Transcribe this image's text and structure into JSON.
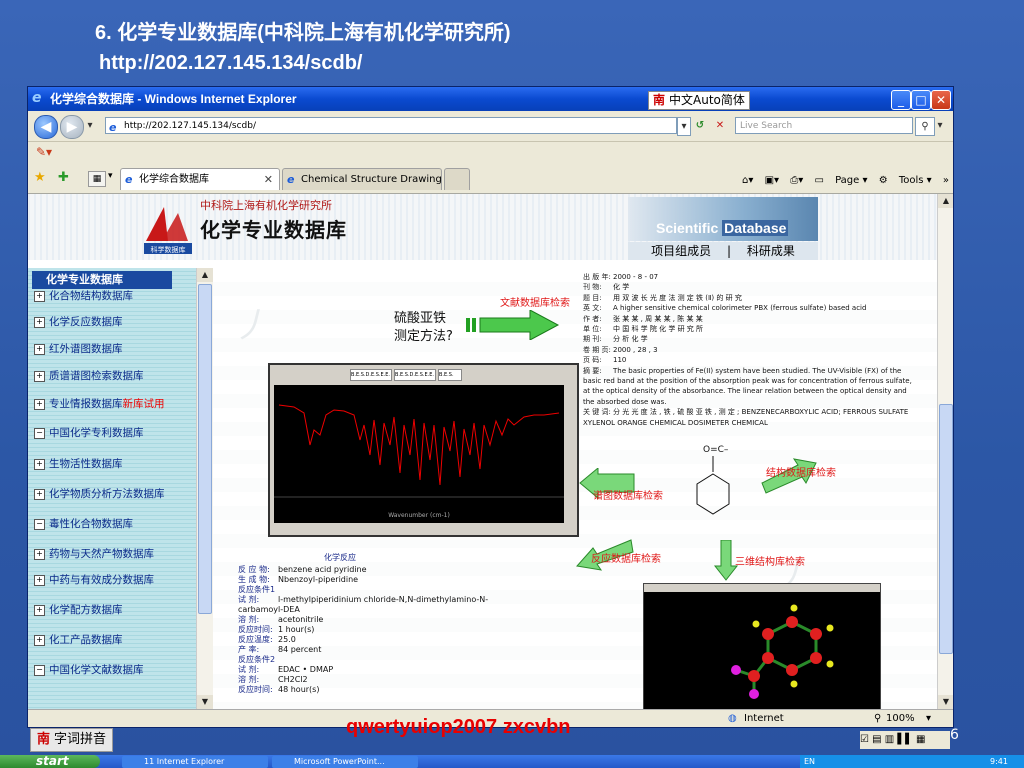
{
  "slide": {
    "title_line1": "6. 化学专业数据库(中科院上海有机化学研究所)",
    "title_line2": "http://202.127.145.134/scdb/",
    "caption": "qwertyuiop2007  zxcvbn",
    "page_number": "6"
  },
  "window": {
    "title": "化学综合数据库 - Windows Internet Explorer",
    "ime_label": "中文Auto简体",
    "ime_char": "南",
    "btn_min": "_",
    "btn_max": "□",
    "btn_close": "✕"
  },
  "address": {
    "url": "http://202.127.145.134/scdb/",
    "search_placeholder": "Live Search"
  },
  "tabs": [
    {
      "label": "化学综合数据库",
      "close": "✕"
    },
    {
      "label": "Chemical Structure Drawing ..."
    }
  ],
  "command_bar": {
    "page": "Page",
    "tools": "Tools"
  },
  "banner": {
    "org": "中科院上海有机化学研究所",
    "title": "化学专业数据库",
    "en_prefix": "Scientific ",
    "en_db": "Database",
    "link_members": "项目组成员",
    "sep": "|",
    "link_results": "科研成果",
    "logo_text": "科学数据库"
  },
  "sidebar": {
    "heading": "化学专业数据库",
    "items": [
      {
        "label": "化合物结构数据库",
        "sym": "+"
      },
      {
        "label": "化学反应数据库",
        "sym": "+"
      },
      {
        "label": "红外谱图数据库",
        "sym": "+"
      },
      {
        "label": "质谱谱图检索数据库",
        "sym": "+"
      },
      {
        "label": "专业情报数据库",
        "sym": "+",
        "hot": "新库试用"
      },
      {
        "label": "中国化学专利数据库",
        "sym": "−"
      },
      {
        "label": "生物活性数据库",
        "sym": "+"
      },
      {
        "label": "化学物质分析方法数据库",
        "sym": "+"
      },
      {
        "label": "毒性化合物数据库",
        "sym": "−"
      },
      {
        "label": "药物与天然产物数据库",
        "sym": "+"
      },
      {
        "label": "中药与有效成分数据库",
        "sym": "+"
      },
      {
        "label": "化学配方数据库",
        "sym": "+"
      },
      {
        "label": "化工产品数据库",
        "sym": "+"
      },
      {
        "label": "中国化学文献数据库",
        "sym": "−"
      }
    ]
  },
  "main": {
    "question_line1": "硫酸亚铁",
    "question_line2": "测定方法?",
    "label_lit": "文献数据库检索",
    "label_spec": "谱图数据库检索",
    "label_struct": "结构数据库检索",
    "label_rxn": "反应数据库检索",
    "label_3d": "三维结构库检索",
    "rxn_heading": "化学反应",
    "rxn_rows": [
      {
        "k": "反 应 物:",
        "v": "benzene acid pyridine"
      },
      {
        "k": "生 成 物:",
        "v": "Nbenzoyl-piperidine"
      },
      {
        "k": "反应条件1",
        "v": ""
      },
      {
        "k": "试    剂:",
        "v": "l-methylpiperidinium chloride-N,N-dimethylamino-N-carbamoyl-DEA"
      },
      {
        "k": "溶    剂:",
        "v": "acetonitrile"
      },
      {
        "k": "反应时间:",
        "v": "1 hour(s)"
      },
      {
        "k": "反应温度:",
        "v": "25.0"
      },
      {
        "k": "产    率:",
        "v": "84 percent"
      },
      {
        "k": "反应条件2",
        "v": ""
      },
      {
        "k": "试    剂:",
        "v": "EDAC • DMAP"
      },
      {
        "k": "溶    剂:",
        "v": "CH2Cl2"
      },
      {
        "k": "反应时间:",
        "v": "48 hour(s)"
      }
    ],
    "abstract_rows": [
      {
        "k": "出 版 年:",
        "v": "2000 - 8 - 07"
      },
      {
        "k": "刊    物:",
        "v": "化 学"
      },
      {
        "k": "题    目:",
        "v": "用 双 波 长 光 度 法 测 定 铁 (Ⅱ) 的 研 究"
      },
      {
        "k": "英    文:",
        "v": "A higher sensitive chemical colorimeter PBX (ferrous sulfate) based acid"
      },
      {
        "k": "作    者:",
        "v": "张 某 某 , 周 某 某 , 陈 某 某"
      },
      {
        "k": "单    位:",
        "v": "中 国 科 学 院 化 学 研 究 所"
      },
      {
        "k": "期    刊:",
        "v": "分 析 化 学"
      },
      {
        "k": "卷 期 页:",
        "v": "2000 , 28 , 3"
      },
      {
        "k": "页    码:",
        "v": "110"
      },
      {
        "k": "摘    要:",
        "v": "The basic properties of Fe(II) system have been studied. The UV-Visible (FX) of the basic red band at the position of the absorption peak was for concentration of ferrous sulfate, at the optical density of the absorbance. The linear relation between the optical density and the absorbed dose was."
      },
      {
        "k": "关 键 词:",
        "v": "分 光 光 度 法 , 铁 , 硫 酸 亚 铁 , 测 定 ; BENZENECARBOXYLIC ACID; FERROUS SULFATE XYLENOL ORANGE CHEMICAL DOSIMETER CHEMICAL"
      }
    ],
    "spectrum_buttons": [
      "B.E.S.D.E.S.E.E.",
      "B.E.S.D.E.S.E.E.",
      "B.E.S."
    ],
    "spectrum_xlabel": "Wavenumber (cm-1)",
    "mol_formula": "O=C–"
  },
  "statusbar": {
    "zone": "Internet",
    "zoom": "100%"
  },
  "ime_bottom": {
    "char": "南",
    "label": "字词拼音"
  },
  "taskbar": {
    "start": "start",
    "task1": "11 Internet Explorer",
    "task2": "Microsoft PowerPoint...",
    "lang": "EN",
    "time": "9:41"
  }
}
